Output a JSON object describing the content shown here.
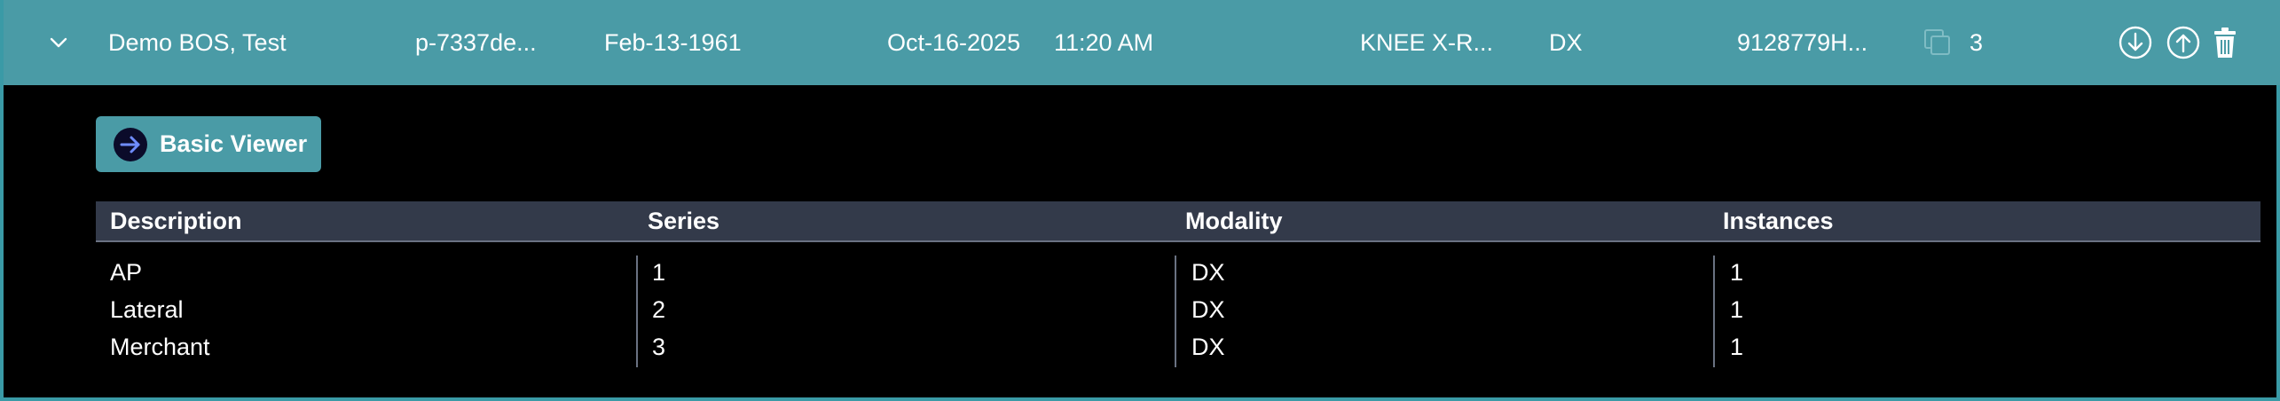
{
  "study": {
    "patient_name": "Demo BOS, Test",
    "mrn": "p-7337de...",
    "dob": "Feb-13-1961",
    "study_date": "Oct-16-2025",
    "study_time": "11:20 AM",
    "description": "KNEE X-R...",
    "modality": "DX",
    "accession": "9128779H...",
    "instances": "3",
    "accent_color": "#4a9ba6"
  },
  "actions": {
    "basic_viewer_label": "Basic Viewer"
  },
  "table": {
    "headers": [
      "Description",
      "Series",
      "Modality",
      "Instances"
    ],
    "rows": [
      [
        "AP",
        "1",
        "DX",
        "1"
      ],
      [
        "Lateral",
        "2",
        "DX",
        "1"
      ],
      [
        "Merchant",
        "3",
        "DX",
        "1"
      ]
    ]
  },
  "icons": {
    "expand": "chevron-down-icon",
    "download": "download-icon",
    "upload": "upload-icon",
    "delete": "trash-icon",
    "instances": "stack-icon",
    "viewer": "arrow-right-icon"
  }
}
